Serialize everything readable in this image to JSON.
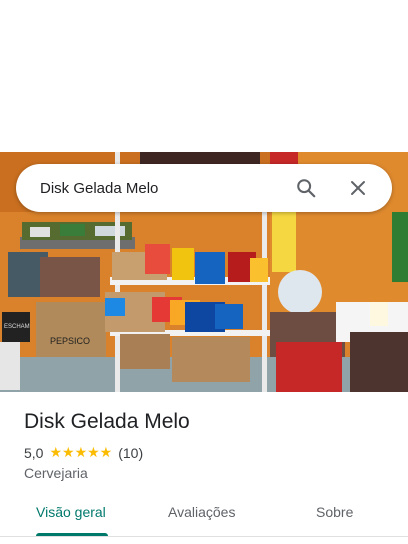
{
  "search": {
    "query": "Disk Gelada Melo"
  },
  "icons": {
    "search": "search-icon",
    "close": "close-icon",
    "star": "star-icon"
  },
  "place": {
    "name": "Disk Gelada Melo",
    "rating": "5,0",
    "stars": "★★★★★",
    "reviews_count": "(10)",
    "category": "Cervejaria"
  },
  "photo": {
    "box_label_1": "PEPSICO",
    "box_label_2": "ESCHAM"
  },
  "tabs": [
    {
      "label": "Visão geral",
      "active": true
    },
    {
      "label": "Avaliações",
      "active": false
    },
    {
      "label": "Sobre",
      "active": false
    }
  ],
  "colors": {
    "accent": "#00796b",
    "star": "#fbbc04",
    "text": "#202124"
  }
}
